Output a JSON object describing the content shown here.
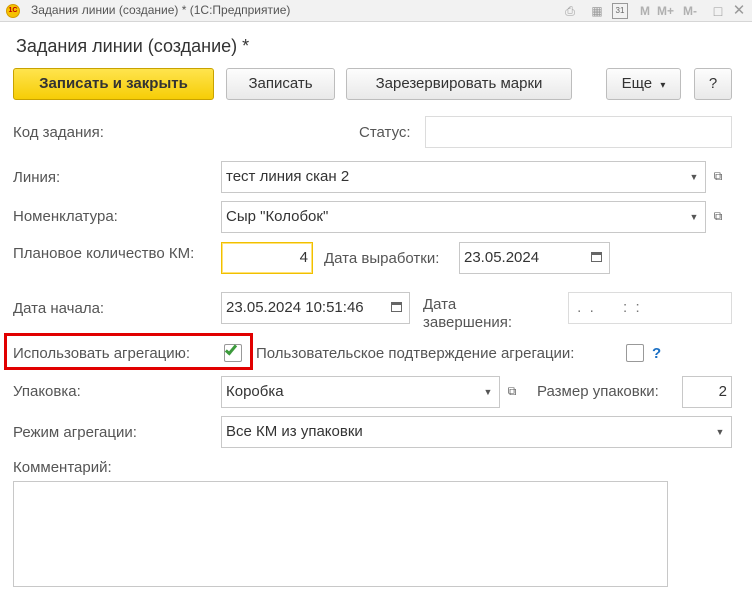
{
  "window": {
    "title": "Задания линии (создание) *  (1С:Предприятие)",
    "app_badge": "1С",
    "calendar_day": "31",
    "toolbar_letters": [
      "M",
      "M+",
      "M-"
    ]
  },
  "form": {
    "title": "Задания линии (создание) *"
  },
  "toolbar": {
    "save_close": "Записать и закрыть",
    "save": "Записать",
    "reserve": "Зарезервировать марки",
    "more": "Еще",
    "more_arrow": "▾",
    "help": "?"
  },
  "fields": {
    "task_code": {
      "label": "Код задания:",
      "value": ""
    },
    "status": {
      "label": "Статус:",
      "value": ""
    },
    "line": {
      "label": "Линия:",
      "value": "тест линия скан 2"
    },
    "nomenclature": {
      "label": "Номенклатура:",
      "value": "Сыр \"Колобок\""
    },
    "planned_qty": {
      "label": "Плановое количество КМ:",
      "value": "4"
    },
    "production_date": {
      "label": "Дата выработки:",
      "value": "23.05.2024"
    },
    "start_date": {
      "label": "Дата начала:",
      "value": "23.05.2024 10:51:46"
    },
    "end_date": {
      "label": "Дата завершения:",
      "value": " .  .       :  :"
    },
    "use_aggregation": {
      "label": "Использовать агрегацию:",
      "checked": true
    },
    "user_confirmation": {
      "label": "Пользовательское подтверждение агрегации:",
      "checked": false,
      "help": "?"
    },
    "packaging": {
      "label": "Упаковка:",
      "value": "Коробка"
    },
    "package_size": {
      "label": "Размер упаковки:",
      "value": "2"
    },
    "aggregation_mode": {
      "label": "Режим агрегации:",
      "value": "Все КМ из упаковки"
    },
    "comment": {
      "label": "Комментарий:",
      "value": ""
    }
  },
  "colors": {
    "primary_button": "#f6cd06",
    "highlight_frame": "#e10000",
    "checkbox_check": "#3c9a3c",
    "help_link": "#1a6fc4"
  }
}
